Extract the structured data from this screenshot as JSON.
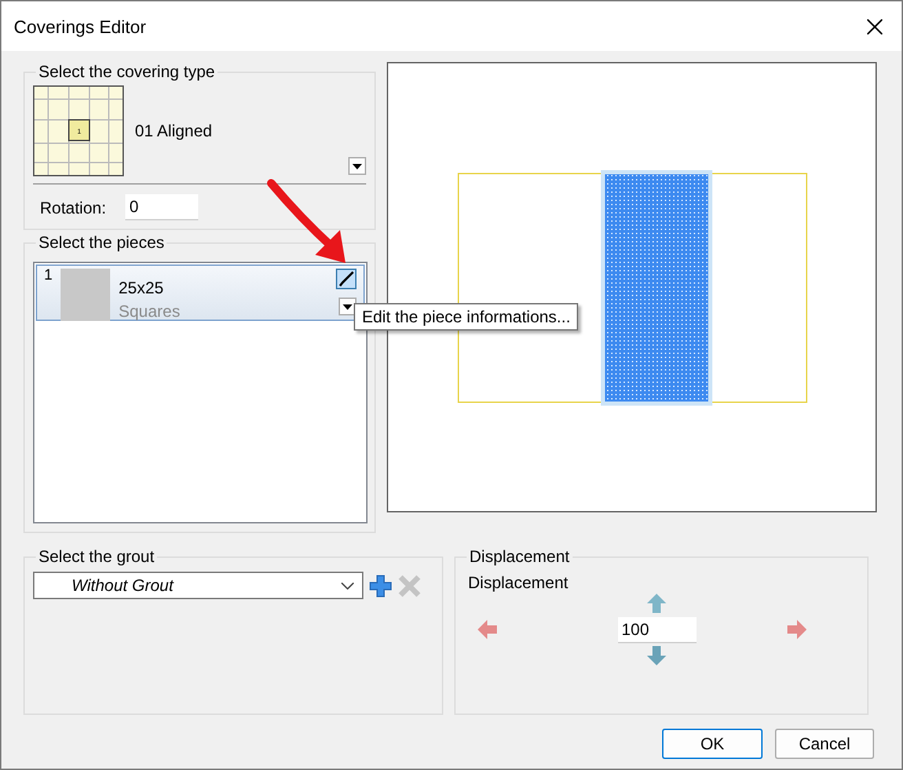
{
  "window": {
    "title": "Coverings Editor"
  },
  "covering_type": {
    "label": "Select the covering type",
    "pattern_name": "01 Aligned",
    "thumbnail_number": "1",
    "rotation_label": "Rotation:",
    "rotation": "0"
  },
  "pieces": {
    "label": "Select the pieces",
    "items": [
      {
        "index": "1",
        "name": "25x25",
        "type": "Squares",
        "selected": true
      }
    ],
    "tooltip": "Edit the piece informations..."
  },
  "grout": {
    "label": "Select the grout",
    "value": "Without Grout",
    "remove_disabled": true
  },
  "displacement": {
    "label": "Displacement",
    "caption": "Displacement",
    "value": "100"
  },
  "buttons": [
    {
      "label": "OK",
      "default": true
    },
    {
      "label": "Cancel",
      "default": false
    }
  ]
}
